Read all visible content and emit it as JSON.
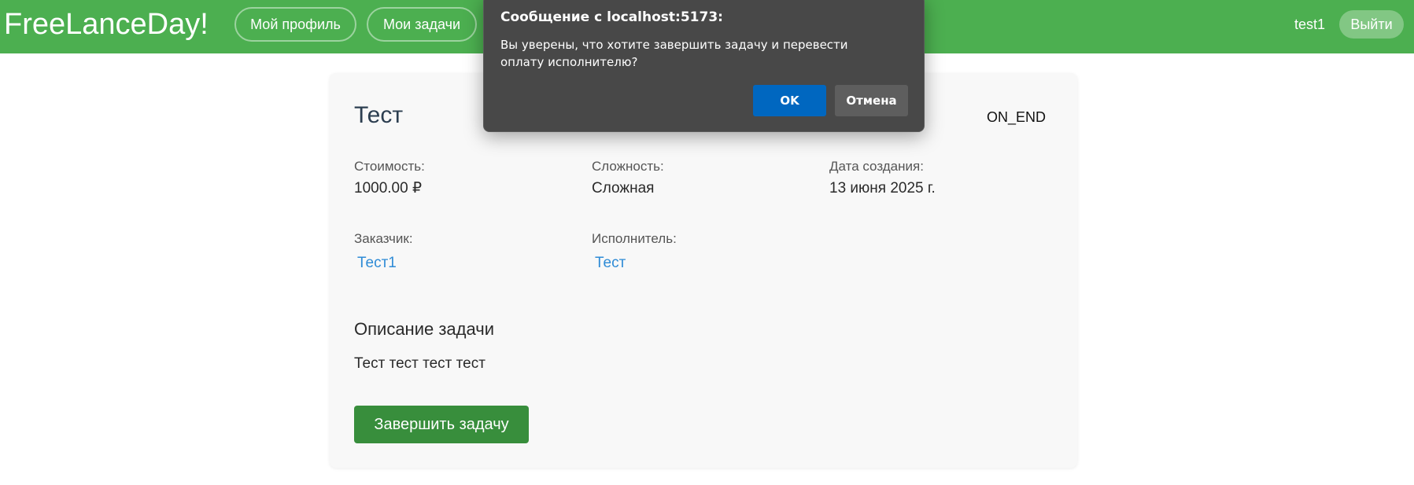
{
  "header": {
    "logo": "FreeLanceDay!",
    "nav": {
      "profile": "Мой профиль",
      "tasks": "Мои задачи"
    },
    "username": "test1",
    "logout": "Выйти"
  },
  "task": {
    "title": "Тест",
    "status": "ON_END",
    "fields": {
      "cost_label": "Стоимость:",
      "cost_value": "1000.00 ₽",
      "difficulty_label": "Сложность:",
      "difficulty_value": "Сложная",
      "created_label": "Дата создания:",
      "created_value": "13 июня 2025 г.",
      "customer_label": "Заказчик:",
      "customer_value": "Тест1",
      "executor_label": "Исполнитель:",
      "executor_value": "Тест"
    },
    "description_title": "Описание задачи",
    "description": "Тест тест тест тест",
    "finish_button": "Завершить задачу"
  },
  "dialog": {
    "title": "Сообщение с localhost:5173:",
    "message": "Вы уверены, что хотите завершить задачу и перевести оплату исполнителю?",
    "ok": "OK",
    "cancel": "Отмена"
  },
  "colors": {
    "header_bg": "#4caf50",
    "finish_button_bg": "#388e3c",
    "link": "#2e8bd6",
    "dialog_bg": "#484848",
    "dialog_ok_bg": "#0067c0"
  }
}
